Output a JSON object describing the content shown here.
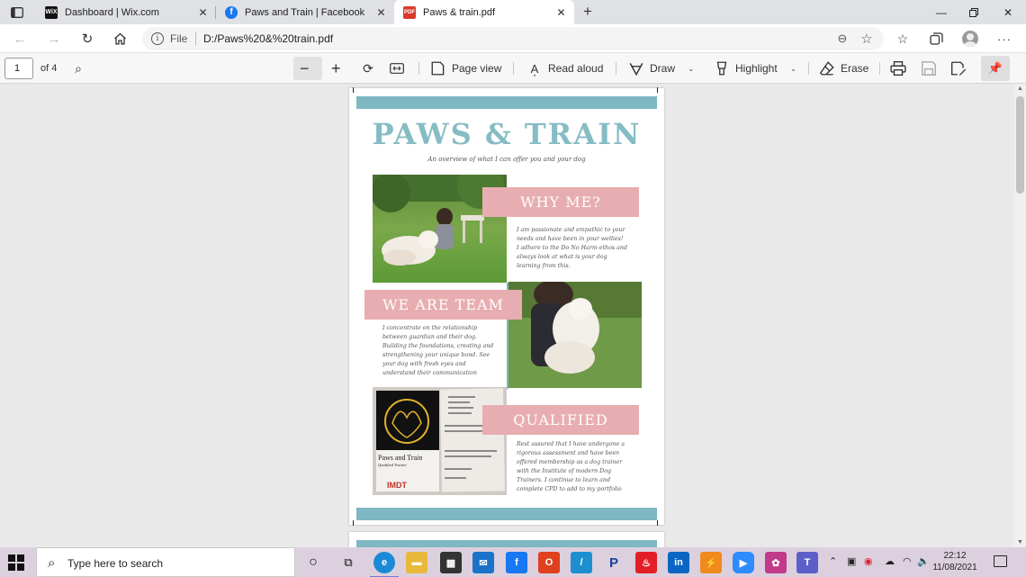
{
  "tabs": [
    {
      "title": "Dashboard | Wix.com",
      "favicon": "WiX",
      "active": false
    },
    {
      "title": "Paws and Train | Facebook",
      "favicon": "f",
      "active": false
    },
    {
      "title": "Paws & train.pdf",
      "favicon": "PDF",
      "active": true
    }
  ],
  "address": {
    "scheme": "File",
    "url": "D:/Paws%20&%20train.pdf"
  },
  "pdf_toolbar": {
    "page_current": "1",
    "page_total": "of 4",
    "page_view": "Page view",
    "read_aloud": "Read aloud",
    "draw": "Draw",
    "highlight": "Highlight",
    "erase": "Erase"
  },
  "doc": {
    "title": "PAWS & TRAIN",
    "subtitle": "An overview of what I can offer you and your dog",
    "sections": [
      {
        "heading": "WHY ME?",
        "text": [
          "I am passionate and empathic to your",
          "needs and have been in your wellies!",
          "I adhere to the Do No Harm ethos and",
          "always look at what is your dog",
          "learning from this."
        ]
      },
      {
        "heading": "WE ARE TEAM",
        "text": [
          "I concentrate on the relationship",
          "between guardian and their dog.",
          "Building the foundations, creating and",
          "strengthening your unique bond. See",
          "your dog with fresh eyes and",
          "understand their communication"
        ]
      },
      {
        "heading": "QUALIFIED",
        "text": [
          "Rest assured that I have undergone a",
          "rigorous assessment and have been",
          "offered membership as a dog trainer",
          "with the Institute of modern Dog",
          "Trainers. I continue to learn and",
          "complete CPD to add to my portfolio"
        ]
      }
    ],
    "card": {
      "brand": "Paws and Train",
      "tagline": "Qualified Trainer",
      "org": "IMDT"
    }
  },
  "taskbar": {
    "search_placeholder": "Type here to search",
    "time": "22:12",
    "date": "11/08/2021"
  },
  "colors": {
    "teal": "#7fb7c2",
    "pink": "#e8adb0",
    "taskbar": "#dcd0de"
  }
}
